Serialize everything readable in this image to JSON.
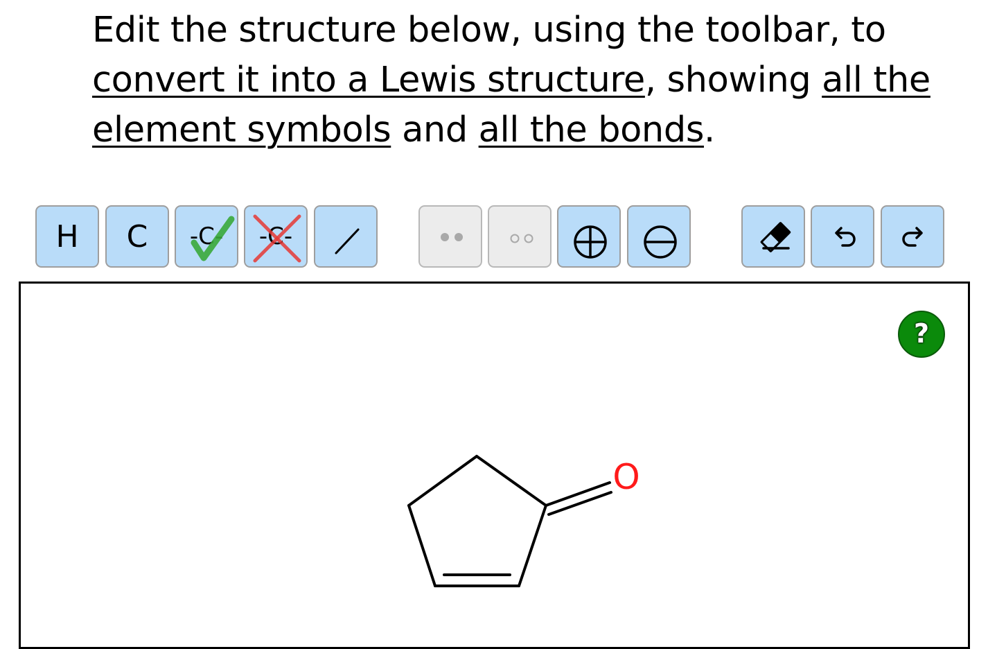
{
  "instructions": {
    "part1": "Edit the structure below, using the toolbar, to ",
    "link1": "convert it into a Lewis structure",
    "part2": ", showing ",
    "link2": "all the element symbols",
    "part3": " and ",
    "link3": "all the bonds",
    "part4": "."
  },
  "toolbar": {
    "hydrogen_label": "H",
    "carbon_label": "C",
    "add_carbon_label": "-C-",
    "remove_carbon_label": "-C-",
    "bond_icon": "single-bond-icon",
    "lone_pair_icon": "lone-pair-icon",
    "radical_icon": "radical-icon",
    "positive_charge_icon": "plus-charge-icon",
    "negative_charge_icon": "minus-charge-icon",
    "eraser_icon": "eraser-icon",
    "undo_icon": "undo-icon",
    "redo_icon": "redo-icon"
  },
  "canvas": {
    "help_label": "?",
    "molecule": {
      "name_hidden": true,
      "oxygen_label": "O",
      "oxygen_color": "#ff1a1a"
    }
  },
  "colors": {
    "button_active": "#b9dcf9",
    "button_disabled": "#ececec",
    "help_green": "#0b8a0b",
    "check_green": "#3aa83a",
    "cross_red": "#e53935"
  }
}
